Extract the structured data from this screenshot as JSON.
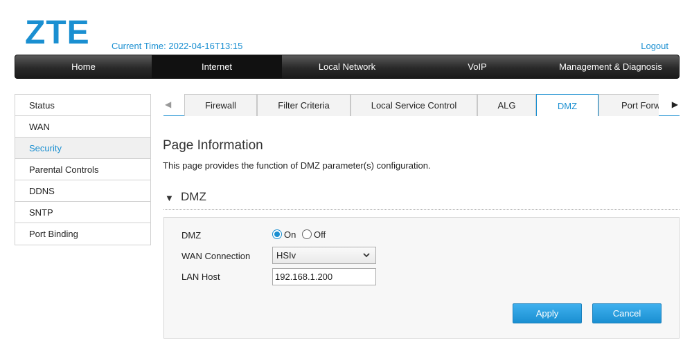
{
  "header": {
    "logo_text": "ZTE",
    "current_time_label": "Current Time: 2022-04-16T13:15",
    "logout_label": "Logout"
  },
  "mainnav": {
    "items": [
      {
        "label": "Home"
      },
      {
        "label": "Internet",
        "active": true
      },
      {
        "label": "Local Network"
      },
      {
        "label": "VoIP"
      },
      {
        "label": "Management & Diagnosis"
      }
    ]
  },
  "sidebar": {
    "items": [
      {
        "label": "Status"
      },
      {
        "label": "WAN"
      },
      {
        "label": "Security",
        "active": true
      },
      {
        "label": "Parental Controls"
      },
      {
        "label": "DDNS"
      },
      {
        "label": "SNTP"
      },
      {
        "label": "Port Binding"
      }
    ]
  },
  "subtabs": {
    "left_arrow_icon": "triangle-left-icon",
    "right_arrow_icon": "triangle-right-icon",
    "items": [
      {
        "label": "Firewall"
      },
      {
        "label": "Filter Criteria"
      },
      {
        "label": "Local Service Control"
      },
      {
        "label": "ALG"
      },
      {
        "label": "DMZ",
        "active": true
      },
      {
        "label": "Port Forw"
      }
    ]
  },
  "page": {
    "title": "Page Information",
    "description": "This page provides the function of DMZ parameter(s) configuration."
  },
  "section": {
    "title": "DMZ",
    "caret_icon": "triangle-down-icon"
  },
  "form": {
    "dmz_label": "DMZ",
    "dmz_on_label": "On",
    "dmz_off_label": "Off",
    "dmz_value": "On",
    "wan_connection_label": "WAN Connection",
    "wan_connection_value": "HSIv",
    "lan_host_label": "LAN Host",
    "lan_host_value": "192.168.1.200",
    "apply_label": "Apply",
    "cancel_label": "Cancel"
  },
  "colors": {
    "accent": "#1a8fd1",
    "nav_bg": "#2a2a2a"
  }
}
